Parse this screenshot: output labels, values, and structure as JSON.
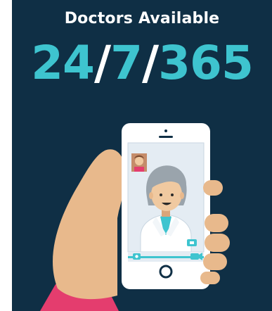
{
  "header": {
    "title": "Doctors Available",
    "availability_parts": [
      "24",
      "/",
      "7",
      "/",
      "365"
    ]
  },
  "colors": {
    "background": "#0f2f45",
    "accent_teal": "#3ec4cf",
    "slash_white": "#ffffff",
    "phone_frame": "#ffffff",
    "screen": "#e4ecf3",
    "skin": "#e8b98c",
    "sleeve": "#e43d6e",
    "toolbar": "#3ec4cf"
  },
  "icons": {
    "self_view": "user-thumbnail-icon",
    "video_toggle": "video-camera-icon",
    "photo": "camera-icon",
    "end_call": "video-camera-icon",
    "home": "home-button-icon"
  }
}
